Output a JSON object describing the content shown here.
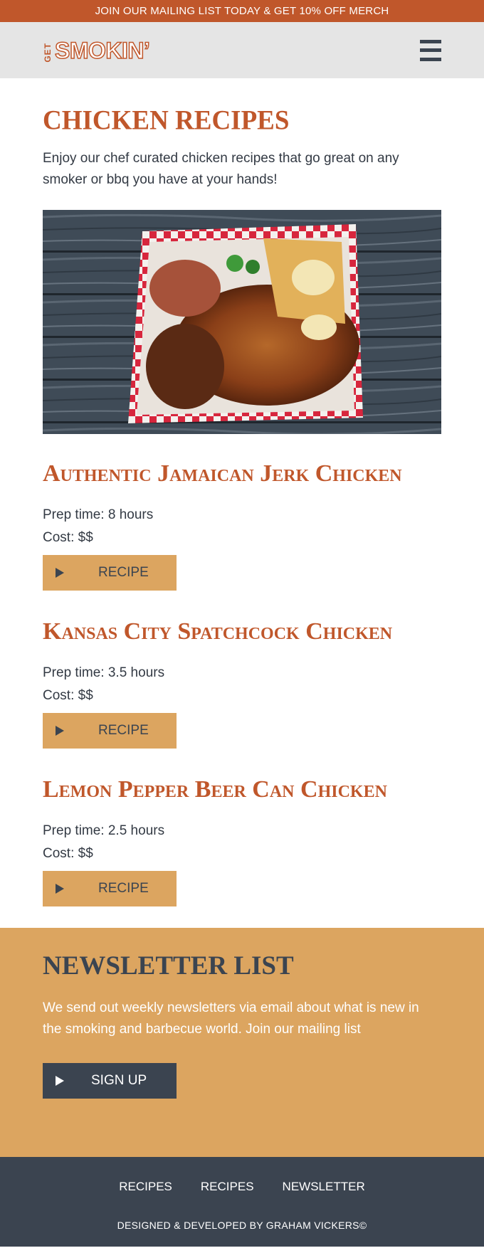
{
  "promo": {
    "text": "JOIN OUR MAILING LIST TODAY & GET 10% OFF MERCH"
  },
  "header": {
    "logo_get": "GET",
    "logo_smokin": "SMOKIN’",
    "menu_icon": "hamburger-menu-icon"
  },
  "main": {
    "title": "CHICKEN RECIPES",
    "intro": "Enjoy our chef curated chicken recipes that go great on any smoker or bbq you have at your hands!",
    "hero_image": "bbq-chicken-platter-photo",
    "recipes": [
      {
        "title": "Authentic Jamaican Jerk Chicken",
        "prep": "Prep time: 8 hours",
        "cost": "Cost: $$",
        "button": "RECIPE"
      },
      {
        "title": "Kansas City Spatchcock Chicken",
        "prep": "Prep time: 3.5 hours",
        "cost": "Cost: $$",
        "button": "RECIPE"
      },
      {
        "title": "Lemon Pepper Beer Can Chicken",
        "prep": "Prep time: 2.5 hours",
        "cost": "Cost: $$",
        "button": "RECIPE"
      }
    ]
  },
  "newsletter": {
    "title": "NEWSLETTER LIST",
    "text": "We send out weekly newsletters via email about what is new in the smoking and barbecue world. Join our mailing list",
    "button": "SIGN UP"
  },
  "footer": {
    "nav": [
      "RECIPES",
      "RECIPES",
      "NEWSLETTER"
    ],
    "credit": "DESIGNED & DEVELOPED BY GRAHAM VICKERS©"
  },
  "colors": {
    "brand_orange": "#c0572b",
    "accent_tan": "#dca560",
    "dark_slate": "#3b4450",
    "header_gray": "#e5e5e5"
  }
}
